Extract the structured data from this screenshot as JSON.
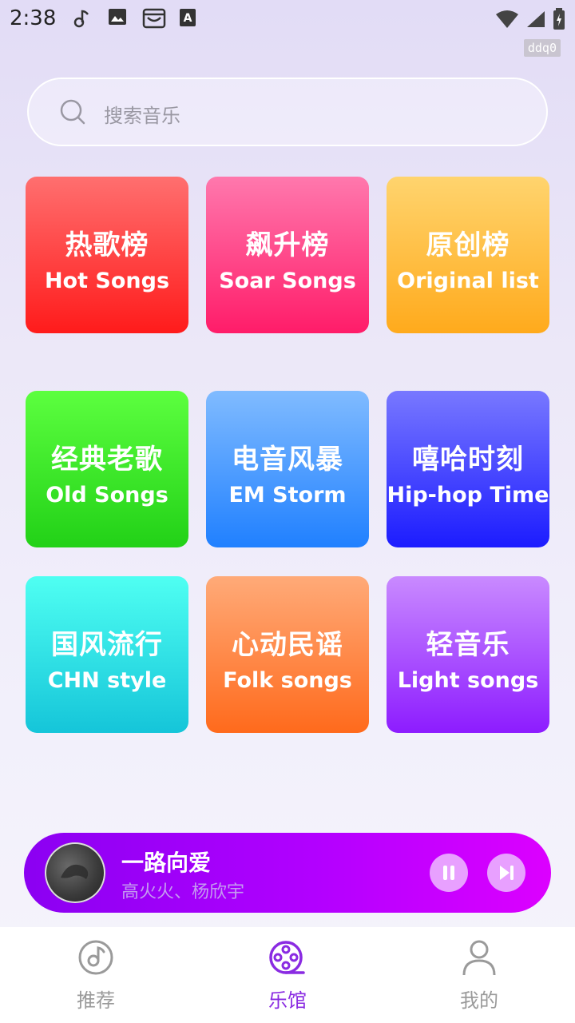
{
  "status_bar": {
    "time": "2:38",
    "tag": "ddq0"
  },
  "search": {
    "placeholder": "搜索音乐"
  },
  "categories": [
    {
      "zh": "热歌榜",
      "en": "Hot Songs"
    },
    {
      "zh": "飙升榜",
      "en": "Soar Songs"
    },
    {
      "zh": "原创榜",
      "en": "Original list"
    },
    {
      "zh": "经典老歌",
      "en": "Old Songs"
    },
    {
      "zh": "电音风暴",
      "en": "EM Storm"
    },
    {
      "zh": "嘻哈时刻",
      "en": "Hip-hop Time"
    },
    {
      "zh": "国风流行",
      "en": "CHN style"
    },
    {
      "zh": "心动民谣",
      "en": "Folk songs"
    },
    {
      "zh": "轻音乐",
      "en": "Light songs"
    }
  ],
  "player": {
    "title": "一路向爱",
    "artist": "高火火、杨欣宇"
  },
  "nav": [
    {
      "label": "推荐",
      "icon": "music-note-icon",
      "active": false
    },
    {
      "label": "乐馆",
      "icon": "film-reel-icon",
      "active": true
    },
    {
      "label": "我的",
      "icon": "person-icon",
      "active": false
    }
  ],
  "colors": {
    "accent": "#8a2be2",
    "hot": [
      "#ff6f6f",
      "#ff1b1b"
    ],
    "soar": [
      "#ff78ad",
      "#ff1c69"
    ],
    "original": [
      "#ffd46e",
      "#ffaa1c"
    ],
    "old": [
      "#5cff3f",
      "#22d117"
    ],
    "em": [
      "#80bbff",
      "#2080ff"
    ],
    "hiphop": [
      "#7878ff",
      "#1c1cff"
    ],
    "chn": [
      "#4ffff2",
      "#15c5d9"
    ],
    "folk": [
      "#ffaa78",
      "#ff6a1c"
    ],
    "light": [
      "#c98aff",
      "#8d1cff"
    ]
  }
}
